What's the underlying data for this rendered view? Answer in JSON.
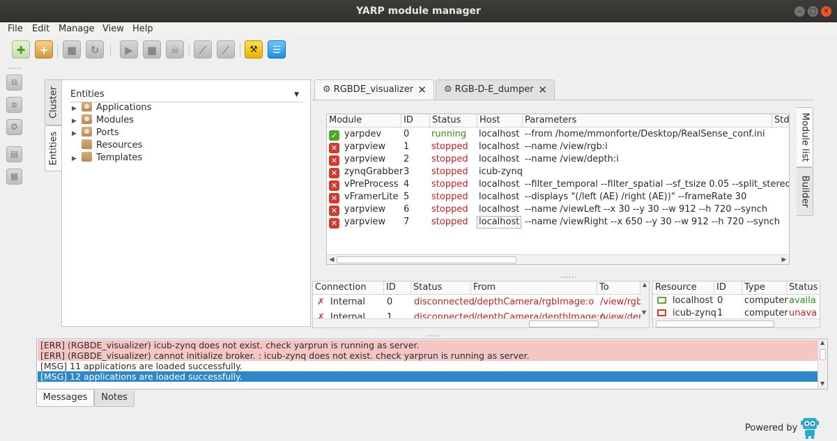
{
  "window": {
    "title": "YARP module manager"
  },
  "menu": [
    "File",
    "Edit",
    "Manage",
    "View",
    "Help"
  ],
  "toolbar": {
    "new_icon": "plus-icon",
    "open_icon": "folder-plus-icon",
    "buttons": [
      "new",
      "open-application",
      "stop-all",
      "refresh",
      "run",
      "stop",
      "kill",
      "connect",
      "disconnect",
      "yarp-builder",
      "module-list"
    ]
  },
  "side_tabs": {
    "cluster": "Cluster",
    "entities": "Entities"
  },
  "entities": {
    "header": "Entities",
    "items": [
      {
        "label": "Applications",
        "expandable": true
      },
      {
        "label": "Modules",
        "expandable": true
      },
      {
        "label": "Ports",
        "expandable": true
      },
      {
        "label": "Resources",
        "expandable": false
      },
      {
        "label": "Templates",
        "expandable": true
      }
    ]
  },
  "doc_tabs": [
    "RGBDE_visualizer",
    "RGB-D-E_dumper"
  ],
  "right_tabs": {
    "module_list": "Module list",
    "builder": "Builder"
  },
  "modules": {
    "headers": [
      "Module",
      "ID",
      "Status",
      "Host",
      "Parameters",
      "Stdi"
    ],
    "rows": [
      {
        "module": "yarpdev",
        "id": "0",
        "status": "running",
        "host": "localhost",
        "params": "--from /home/mmonforte/Desktop/RealSense_conf.ini",
        "ok": true
      },
      {
        "module": "yarpview",
        "id": "1",
        "status": "stopped",
        "host": "localhost",
        "params": "--name /view/rgb:i",
        "ok": false
      },
      {
        "module": "yarpview",
        "id": "2",
        "status": "stopped",
        "host": "localhost",
        "params": "--name /view/depth:i",
        "ok": false
      },
      {
        "module": "zynqGrabber",
        "id": "3",
        "status": "stopped",
        "host": "icub-zynq",
        "params": "",
        "ok": false
      },
      {
        "module": "vPreProcess",
        "id": "4",
        "status": "stopped",
        "host": "localhost",
        "params": "--filter_temporal --filter_spatial --sf_tsize 0.05 --split_stereo",
        "ok": false
      },
      {
        "module": "vFramerLite",
        "id": "5",
        "status": "stopped",
        "host": "localhost",
        "params": "--displays \"(/left (AE) /right (AE))\" --frameRate 30",
        "ok": false
      },
      {
        "module": "yarpview",
        "id": "6",
        "status": "stopped",
        "host": "localhost",
        "params": "--name /viewLeft --x 30 --y 30 --w 912 --h 720 --synch",
        "ok": false
      },
      {
        "module": "yarpview",
        "id": "7",
        "status": "stopped",
        "host": "localhost",
        "params": "--name /viewRight --x 650 --y 30 --w 912 --h 720 --synch",
        "ok": false
      }
    ]
  },
  "connections": {
    "headers": [
      "Connection",
      "ID",
      "Status",
      "From",
      "To"
    ],
    "rows": [
      {
        "connection": "Internal",
        "id": "0",
        "status": "disconnected",
        "from": "/depthCamera/rgbImage:o",
        "to": "/view/rgb:"
      },
      {
        "connection": "Internal",
        "id": "1",
        "status": "disconnected",
        "from": "/depthCamera/depthImage:o",
        "to": "/view/dep"
      }
    ]
  },
  "resources": {
    "headers": [
      "Resource",
      "ID",
      "Type",
      "Status"
    ],
    "rows": [
      {
        "resource": "localhost",
        "id": "0",
        "type": "computer",
        "status": "availa",
        "ok": true
      },
      {
        "resource": "icub-zynq",
        "id": "1",
        "type": "computer",
        "status": "unava",
        "ok": false
      }
    ]
  },
  "messages": [
    {
      "text": "[ERR] (RGBDE_visualizer) icub-zynq does not exist. check yarprun is running as server.",
      "kind": "err"
    },
    {
      "text": "[ERR] (RGBDE_visualizer) cannot initialize broker. : icub-zynq does not exist. check yarprun is running as server.",
      "kind": "err"
    },
    {
      "text": "[MSG] 11 applications are loaded successfully.",
      "kind": "msg"
    },
    {
      "text": "[MSG] 12 applications are loaded successfully.",
      "kind": "sel"
    }
  ],
  "bottom_tabs": [
    "Messages",
    "Notes"
  ],
  "footer": {
    "powered_by": "Powered by"
  },
  "colors": {
    "running": "#2c8f18",
    "stopped": "#c72020",
    "selection": "#2d87ca",
    "error_row": "#f5c6c4"
  }
}
